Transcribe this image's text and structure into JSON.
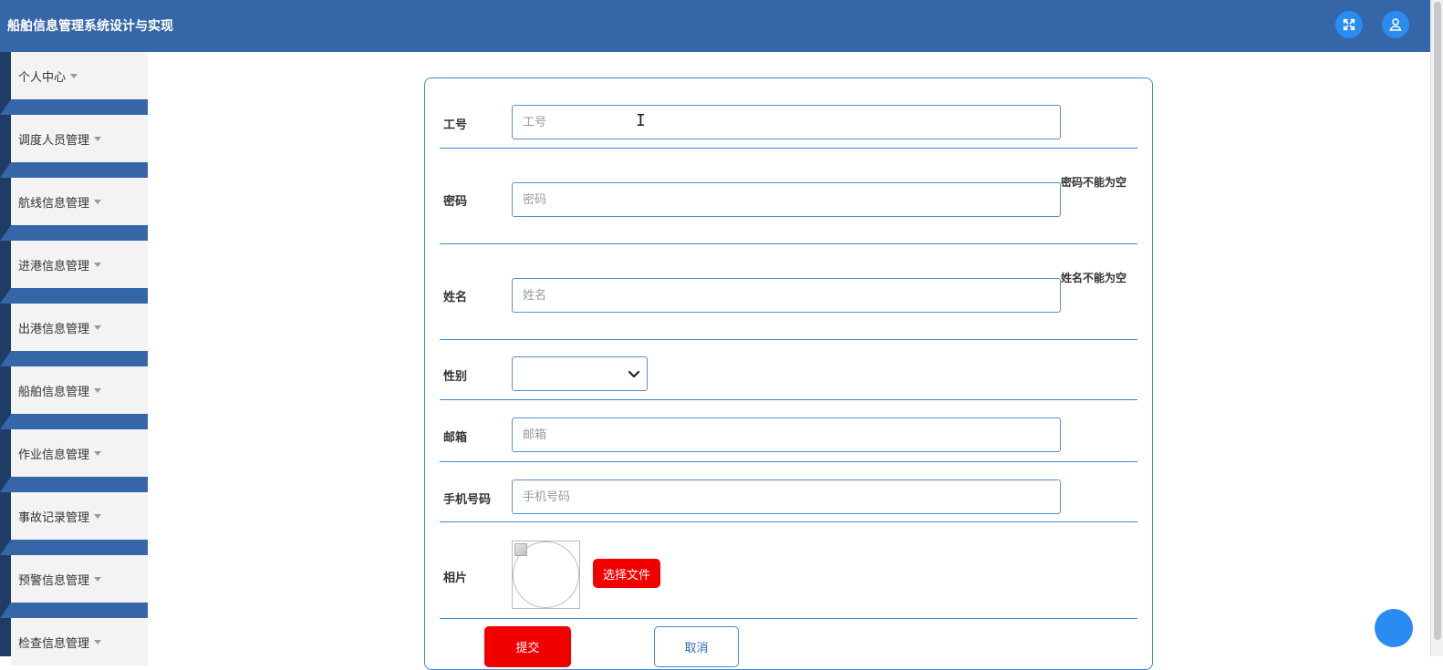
{
  "header": {
    "title": "船舶信息管理系统设计与实现",
    "fullscreen_icon": "fullscreen-icon",
    "user_icon": "user-icon"
  },
  "sidebar": {
    "items": [
      {
        "label": "个人中心"
      },
      {
        "label": "调度人员管理"
      },
      {
        "label": "航线信息管理"
      },
      {
        "label": "进港信息管理"
      },
      {
        "label": "出港信息管理"
      },
      {
        "label": "船舶信息管理"
      },
      {
        "label": "作业信息管理"
      },
      {
        "label": "事故记录管理"
      },
      {
        "label": "预警信息管理"
      },
      {
        "label": "检查信息管理"
      }
    ]
  },
  "form": {
    "id_field": {
      "label": "工号",
      "placeholder": "工号",
      "value": ""
    },
    "password_field": {
      "label": "密码",
      "placeholder": "密码",
      "value": "",
      "error": "密码不能为空"
    },
    "name_field": {
      "label": "姓名",
      "placeholder": "姓名",
      "value": "",
      "error": "姓名不能为空"
    },
    "gender_field": {
      "label": "性别",
      "value": ""
    },
    "email_field": {
      "label": "邮箱",
      "placeholder": "邮箱",
      "value": ""
    },
    "phone_field": {
      "label": "手机号码",
      "placeholder": "手机号码",
      "value": ""
    },
    "photo_field": {
      "label": "相片",
      "file_button": "选择文件"
    },
    "submit_label": "提交",
    "cancel_label": "取消"
  },
  "colors": {
    "header_bg": "#3566a8",
    "accent": "#3d8ad6",
    "danger": "#f20000",
    "icon_bg": "#2a8cf0"
  }
}
